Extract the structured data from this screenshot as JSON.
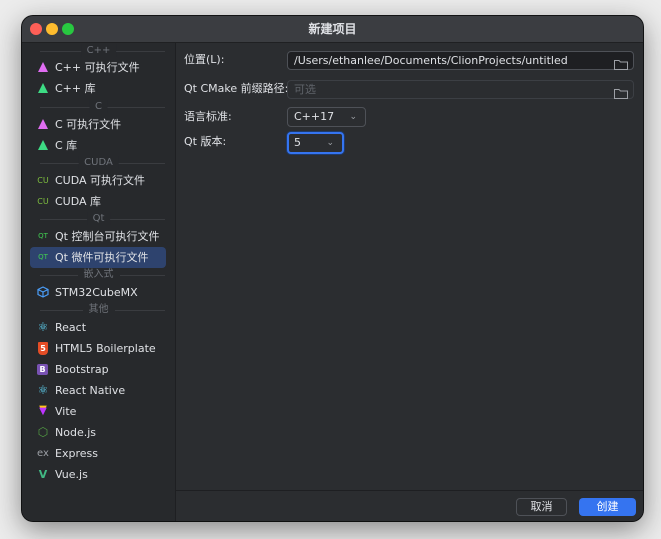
{
  "window": {
    "title": "新建项目"
  },
  "sidebar": {
    "groups": [
      {
        "title": "C++"
      },
      {
        "title": "C"
      },
      {
        "title": "CUDA"
      },
      {
        "title": "Qt"
      },
      {
        "title": "嵌入式"
      },
      {
        "title": "其他"
      }
    ],
    "items": [
      {
        "label": "C++ 可执行文件",
        "icon": "clion-icon"
      },
      {
        "label": "C++ 库",
        "icon": "clion-icon"
      },
      {
        "label": "C 可执行文件",
        "icon": "clion-icon"
      },
      {
        "label": "C 库",
        "icon": "clion-icon"
      },
      {
        "label": "CUDA 可执行文件",
        "icon": "cuda-icon",
        "glyph": "CU"
      },
      {
        "label": "CUDA 库",
        "icon": "cuda-icon",
        "glyph": "CU"
      },
      {
        "label": "Qt 控制台可执行文件",
        "icon": "qt-icon",
        "glyph": "QT"
      },
      {
        "label": "Qt 微件可执行文件",
        "icon": "qt-icon",
        "glyph": "QT",
        "selected": true
      },
      {
        "label": "STM32CubeMX",
        "icon": "cube-icon"
      },
      {
        "label": "React",
        "icon": "react-icon",
        "glyph": "⚛"
      },
      {
        "label": "HTML5 Boilerplate",
        "icon": "html5-icon",
        "glyph": "5"
      },
      {
        "label": "Bootstrap",
        "icon": "bootstrap-icon",
        "glyph": "B"
      },
      {
        "label": "React Native",
        "icon": "react-icon",
        "glyph": "⚛"
      },
      {
        "label": "Vite",
        "icon": "vite-icon",
        "glyph": "▼"
      },
      {
        "label": "Node.js",
        "icon": "nodejs-icon",
        "glyph": "⬡"
      },
      {
        "label": "Express",
        "icon": "express-icon",
        "glyph": "ex"
      },
      {
        "label": "Vue.js",
        "icon": "vue-icon",
        "glyph": "V"
      }
    ]
  },
  "form": {
    "location": {
      "label": "位置(L):",
      "value": "/Users/ethanlee/Documents/ClionProjects/untitled"
    },
    "cmake_prefix": {
      "label": "Qt CMake 前缀路径:",
      "placeholder": "可选"
    },
    "language": {
      "label": "语言标准:",
      "value": "C++17"
    },
    "qt_version": {
      "label": "Qt 版本:",
      "value": "5"
    }
  },
  "footer": {
    "cancel_label": "取消",
    "create_label": "创建"
  },
  "colors": {
    "accent": "#3574f0",
    "background": "#2b2d30",
    "sidebar": "#27292c",
    "selected": "#2e436e"
  }
}
